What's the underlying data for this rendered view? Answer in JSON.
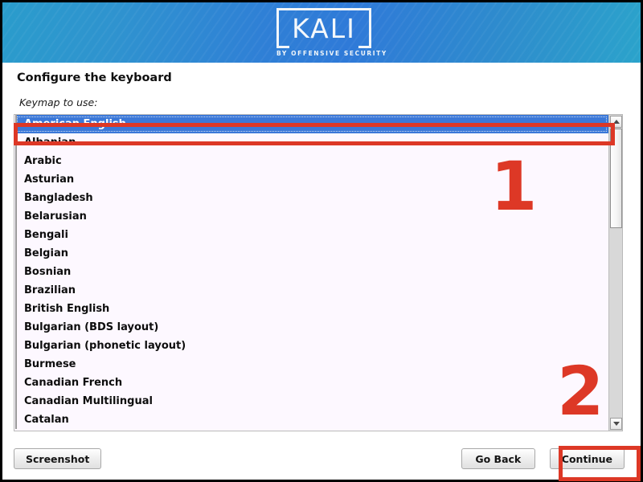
{
  "window": {
    "frame_color": "#000000"
  },
  "banner": {
    "logo_word": "KALI",
    "logo_tagline": "BY OFFENSIVE SECURITY",
    "gradient_edge_color": "#2a9ccc",
    "gradient_center_color": "#2f7ad8"
  },
  "step": {
    "title": "Configure the keyboard"
  },
  "question": {
    "field_label": "Keymap to use:",
    "selected_value": "American English",
    "keymaps": [
      "American English",
      "Albanian",
      "Arabic",
      "Asturian",
      "Bangladesh",
      "Belarusian",
      "Bengali",
      "Belgian",
      "Bosnian",
      "Brazilian",
      "British English",
      "Bulgarian (BDS layout)",
      "Bulgarian (phonetic layout)",
      "Burmese",
      "Canadian French",
      "Canadian Multilingual",
      "Catalan"
    ]
  },
  "scrollbar": {
    "up_icon": "chevron-up-icon",
    "down_icon": "chevron-down-icon"
  },
  "annotations": {
    "color": "#dd3826",
    "step_one": "1",
    "step_two": "2"
  },
  "footer": {
    "screenshot_label": "Screenshot",
    "go_back_label": "Go Back",
    "continue_label": "Continue"
  }
}
